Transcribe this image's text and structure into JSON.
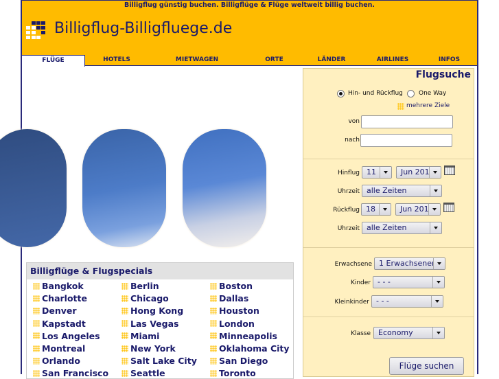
{
  "header": {
    "tagline": "Billigflug günstig buchen. Billigflüge & Flüge weltweit billig buchen.",
    "site_name": "Billigflug-Billigfluege.de"
  },
  "nav": {
    "tabs": [
      {
        "label": "FLÜGE",
        "active": true
      },
      {
        "label": "HOTELS"
      },
      {
        "label": "MIETWAGEN"
      },
      {
        "label": "ORTE"
      },
      {
        "label": "LÄNDER"
      },
      {
        "label": "AIRLINES"
      },
      {
        "label": "INFOS"
      }
    ]
  },
  "specials": {
    "title": "Billigflüge & Flugspecials",
    "cities": [
      "Bangkok",
      "Berlin",
      "Boston",
      "Charlotte",
      "Chicago",
      "Dallas",
      "Denver",
      "Hong Kong",
      "Houston",
      "Kapstadt",
      "Las Vegas",
      "London",
      "Los Angeles",
      "Miami",
      "Minneapolis",
      "Montreal",
      "New York",
      "Oklahoma City",
      "Orlando",
      "Salt Lake City",
      "San Diego",
      "San Francisco",
      "Seattle",
      "Toronto"
    ]
  },
  "search": {
    "title": "Flugsuche",
    "trip_roundtrip": "Hin- und Rückflug",
    "trip_oneway": "One Way",
    "multi": "mehrere Ziele",
    "from_label": "von",
    "from_value": "",
    "to_label": "nach",
    "to_value": "",
    "outbound_label": "Hinflug",
    "outbound_day": "11",
    "outbound_month": "Jun 201",
    "time_label": "Uhrzeit",
    "outbound_time": "alle Zeiten",
    "return_label": "Rückflug",
    "return_day": "18",
    "return_month": "Jun 201",
    "return_time": "alle Zeiten",
    "adults_label": "Erwachsene",
    "adults": "1 Erwachsener",
    "children_label": "Kinder",
    "children": "- - -",
    "infants_label": "Kleinkinder",
    "infants": "- - -",
    "class_label": "Klasse",
    "class": "Economy",
    "submit": "Flüge suchen"
  },
  "colors": {
    "header": "#ffbb00",
    "panel": "#fff0c0",
    "text": "#1a1a6a"
  }
}
